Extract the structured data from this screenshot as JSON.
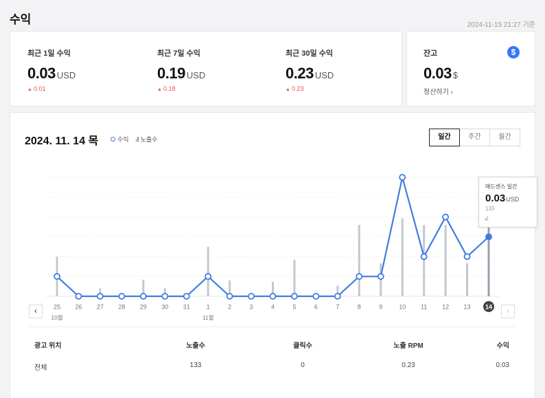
{
  "header": {
    "title": "수익",
    "timestamp": "2024-11-15 21:27 기준"
  },
  "summary": [
    {
      "label": "최근 1일 수익",
      "value": "0.03",
      "unit": "USD",
      "delta": "0.01"
    },
    {
      "label": "최근 7일 수익",
      "value": "0.19",
      "unit": "USD",
      "delta": "0.18"
    },
    {
      "label": "최근 30일 수익",
      "value": "0.23",
      "unit": "USD",
      "delta": "0.23"
    }
  ],
  "balance": {
    "label": "잔고",
    "value": "0.03",
    "unit": "$",
    "icon": "dollar-icon",
    "settle_link": "정산하기",
    "settle_arrow": "›"
  },
  "chart_header": {
    "date": "2024. 11. 14 목",
    "legend_revenue": "수익",
    "legend_impressions": "노출수",
    "period_tabs": [
      "일간",
      "주간",
      "월간"
    ],
    "active_tab": "일간"
  },
  "navigation": {
    "prev": "‹",
    "next": "›"
  },
  "tooltip": {
    "title": "애드센스 일간",
    "value": "0.03",
    "unit": "USD",
    "impressions": "133"
  },
  "colors": {
    "line": "#3f7be0",
    "bar": "#c3c8cf",
    "accent": "#3478f6",
    "delta_up": "#e8573f",
    "selected_day": "#444444"
  },
  "chart_data": {
    "type": "line",
    "x": [
      "25",
      "26",
      "27",
      "28",
      "29",
      "30",
      "31",
      "1",
      "2",
      "3",
      "4",
      "5",
      "6",
      "7",
      "8",
      "9",
      "10",
      "11",
      "12",
      "13",
      "14"
    ],
    "month_labels": [
      {
        "index": 0,
        "label": "10월"
      },
      {
        "index": 7,
        "label": "11월"
      }
    ],
    "selected_index": 20,
    "series": [
      {
        "name": "수익",
        "type": "line",
        "values": [
          0.01,
          0,
          0,
          0,
          0,
          0,
          0,
          0.01,
          0,
          0,
          0,
          0,
          0,
          0,
          0.01,
          0.01,
          0.06,
          0.02,
          0.04,
          0.02,
          0.03
        ]
      },
      {
        "name": "노출수",
        "type": "bar",
        "values": [
          60,
          0,
          12,
          0,
          25,
          12,
          0,
          75,
          24,
          0,
          22,
          55,
          0,
          16,
          108,
          50,
          118,
          108,
          108,
          50,
          133
        ]
      }
    ],
    "ylim_revenue": [
      0,
      0.06
    ],
    "ylim_impressions": [
      0,
      180
    ],
    "grid": true
  },
  "table": {
    "headers": [
      "광고 위치",
      "노출수",
      "클릭수",
      "노출 RPM",
      "수익"
    ],
    "rows": [
      [
        "전체",
        "133",
        "0",
        "0.23",
        "0.03"
      ]
    ]
  }
}
